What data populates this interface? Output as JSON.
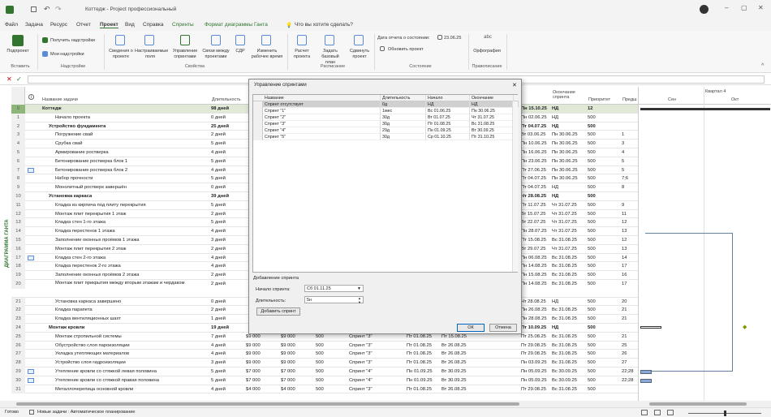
{
  "titlebar": {
    "autosave": "Автосохранение",
    "title": "Коттедж - Project профессиональный"
  },
  "tabs": [
    "Файл",
    "Задача",
    "Ресурс",
    "Отчет",
    "Проект",
    "Вид",
    "Справка",
    "Спринты",
    "Формат диаграммы Ганта"
  ],
  "tell_me": "Что вы хотите сделать?",
  "ribbon": {
    "btn_subproject": "Подпроект",
    "btn_get_addins": "Получить надстройки",
    "btn_my_addins": "Мои надстройки",
    "btn_project_info": "Сведения о проекте",
    "btn_custom_fields": "Настраиваемые поля",
    "btn_sprints": "Управление спринтами",
    "btn_links": "Связи между проектами",
    "btn_wbs": "СДР",
    "btn_work_time": "Изменить рабочее время",
    "btn_calc": "Расчет проекта",
    "btn_baseline": "Задать базовый план",
    "btn_move": "Сдвинуть проект",
    "status_date_label": "Дата отчета о состоянии:",
    "status_date": "23.06.25",
    "btn_update": "Обновить проект",
    "btn_spelling": "Орфография",
    "grp_insert": "Вставить",
    "grp_addins": "Надстройки",
    "grp_props": "Свойства",
    "grp_schedule": "Расписание",
    "grp_status": "Состояние",
    "grp_proofing": "Правописание"
  },
  "view_label": "ДИАГРАММА ГАНТА",
  "columns": {
    "name": "Название задачи",
    "duration": "Длительность",
    "start": "Начало",
    "finish": "Окончание",
    "prev": "Предш.",
    "finish2": "Окончание спринта",
    "priority": "Приоритет",
    "pred2": "Предш"
  },
  "rows": [
    {
      "id": "0",
      "name": "Коттедж",
      "dur": "98 дней",
      "start": "Пн 15.10.25",
      "fin": "НД",
      "pri": "12",
      "pred": "",
      "bold": true,
      "lvl": 0
    },
    {
      "id": "1",
      "name": "Начало проекта",
      "dur": "0 дней",
      "start": "Пн 02.06.25",
      "fin": "НД",
      "pri": "500",
      "pred": "",
      "bold": false,
      "lvl": 2
    },
    {
      "id": "2",
      "name": "Устройство фундамента",
      "dur": "25 дней",
      "start": "Пт 04.07.25",
      "fin": "НД",
      "pri": "500",
      "pred": "",
      "bold": true,
      "lvl": 1
    },
    {
      "id": "3",
      "name": "Погружение свай",
      "dur": "2 дней",
      "start": "Вт 03.06.25",
      "fin": "Пн 30.06.25",
      "pri": "500",
      "pred": "1",
      "bold": false,
      "lvl": 2
    },
    {
      "id": "4",
      "name": "Срубка свай",
      "dur": "5 дней",
      "start": "Пн 10.06.25",
      "fin": "Пн 30.06.25",
      "pri": "500",
      "pred": "3",
      "bold": false,
      "lvl": 2
    },
    {
      "id": "5",
      "name": "Армирование ростверка",
      "dur": "4 дней",
      "start": "Пн 16.06.25",
      "fin": "Пн 30.06.25",
      "pri": "500",
      "pred": "4",
      "bold": false,
      "lvl": 2
    },
    {
      "id": "6",
      "name": "Бетонирование ростверка блок 1",
      "dur": "5 дней",
      "start": "Пн 23.06.25",
      "fin": "Пн 30.06.25",
      "pri": "500",
      "pred": "5",
      "bold": false,
      "lvl": 2
    },
    {
      "id": "7",
      "name": "Бетонирование ростверка блок 2",
      "dur": "4 дней",
      "start": "Пт 27.06.25",
      "fin": "Пн 30.06.25",
      "pri": "500",
      "pred": "5",
      "bold": false,
      "lvl": 2
    },
    {
      "id": "8",
      "name": "Набор прочности",
      "dur": "5 дней",
      "start": "Пт 04.07.25",
      "fin": "Пн 30.06.25",
      "pri": "500",
      "pred": "7;6",
      "bold": false,
      "lvl": 2
    },
    {
      "id": "9",
      "name": "Монолитный ростверк завершён",
      "dur": "0 дней",
      "start": "Пт 04.07.25",
      "fin": "НД",
      "pri": "500",
      "pred": "8",
      "bold": false,
      "lvl": 2
    },
    {
      "id": "10",
      "name": "Установка каркаса",
      "dur": "39 дней",
      "start": "Чт 28.08.25",
      "fin": "НД",
      "pri": "500",
      "pred": "",
      "bold": true,
      "lvl": 1
    },
    {
      "id": "11",
      "name": "Кладка из кирпича под плиту перекрытия",
      "dur": "5 дней",
      "start": "Пт 11.07.25",
      "fin": "Чт 31.07.25",
      "pri": "500",
      "pred": "9",
      "bold": false,
      "lvl": 2
    },
    {
      "id": "12",
      "name": "Монтаж плит перекрытия 1 этаж",
      "dur": "2 дней",
      "start": "Вт 15.07.25",
      "fin": "Чт 31.07.25",
      "pri": "500",
      "pred": "11",
      "bold": false,
      "lvl": 2
    },
    {
      "id": "13",
      "name": "Кладка стен 1-го этажа",
      "dur": "5 дней",
      "start": "Вт 22.07.25",
      "fin": "Чт 31.07.25",
      "pri": "500",
      "pred": "12",
      "bold": false,
      "lvl": 2
    },
    {
      "id": "14",
      "name": "Кладка перестенок 1 этажа",
      "dur": "4 дней",
      "start": "Пн 28.07.25",
      "fin": "Чт 31.07.25",
      "pri": "500",
      "pred": "13",
      "bold": false,
      "lvl": 2
    },
    {
      "id": "15",
      "name": "Заполнение оконных проёмов 1 этажа",
      "dur": "3 дней",
      "start": "Пт 15.08.25",
      "fin": "Вс 31.08.25",
      "pri": "500",
      "pred": "12",
      "bold": false,
      "lvl": 2
    },
    {
      "id": "16",
      "name": "Монтаж плит перекрытия 2 этаж",
      "dur": "2 дней",
      "start": "Вт 29.07.25",
      "fin": "Чт 31.07.25",
      "pri": "500",
      "pred": "13",
      "bold": false,
      "lvl": 2
    },
    {
      "id": "17",
      "name": "Кладка стен 2-го этажа",
      "dur": "4 дней",
      "start": "Пн 06.08.25",
      "fin": "Вс 31.08.25",
      "pri": "500",
      "pred": "14",
      "bold": false,
      "lvl": 2
    },
    {
      "id": "18",
      "name": "Кладка перестенок 2-го этажа",
      "dur": "4 дней",
      "start": "Пн 14.08.25",
      "fin": "Вс 31.08.25",
      "pri": "500",
      "pred": "17",
      "bold": false,
      "lvl": 2
    },
    {
      "id": "19",
      "name": "Заполнение оконных проёмов 2 этажа",
      "dur": "2 дней",
      "start": "Пн 15.08.25",
      "fin": "Вс 31.08.25",
      "pri": "500",
      "pred": "16",
      "bold": false,
      "lvl": 2
    },
    {
      "id": "20",
      "name": "Монтаж плит прикрытия между вторым этажам и чердаком",
      "dur": "2 дней",
      "start": "Пн 14.08.25",
      "fin": "Вс 31.08.25",
      "pri": "500",
      "pred": "17",
      "bold": false,
      "lvl": 2,
      "tall": true
    },
    {
      "id": "21",
      "name": "Установка каркаса завершено",
      "dur": "0 дней",
      "start": "Чт 28.08.25",
      "fin": "НД",
      "pri": "500",
      "pred": "20",
      "bold": false,
      "lvl": 2
    },
    {
      "id": "22",
      "name": "Кладка парапета",
      "dur": "2 дней",
      "start": "Пн 26.08.25",
      "fin": "Вс 31.08.25",
      "pri": "500",
      "pred": "21",
      "bold": false,
      "lvl": 2
    },
    {
      "id": "23",
      "name": "Кладка вентиляционных шахт",
      "dur": "1 дней",
      "start": "Пн 28.08.25",
      "fin": "Вс 31.08.25",
      "pri": "500",
      "pred": "21",
      "bold": false,
      "lvl": 2
    },
    {
      "id": "24",
      "name": "Монтаж кровли",
      "dur": "19 дней",
      "start": "Пт 10.09.25",
      "fin": "НД",
      "pri": "500",
      "pred": "",
      "bold": true,
      "lvl": 1
    },
    {
      "id": "25",
      "name": "Монтаж стропильной системы",
      "dur": "7 дней",
      "cost": "$9 000",
      "cost2": "$9 000",
      "w": "500",
      "sprint": "Спринт \"3\"",
      "s": "Пт 01.08.25",
      "f": "Пт 15.08.25",
      "start": "Пт 25.08.25",
      "fin": "Вс 31.08.25",
      "pri": "500",
      "pred": "21",
      "bold": false,
      "lvl": 2
    },
    {
      "id": "26",
      "name": "Обустройство слоя пароизоляции",
      "dur": "4 дней",
      "cost": "$9 000",
      "cost2": "$9 000",
      "w": "500",
      "sprint": "Спринт \"3\"",
      "s": "Пт 01.08.25",
      "f": "Вт 26.08.25",
      "start": "Пт 29.08.25",
      "fin": "Вс 31.08.25",
      "pri": "500",
      "pred": "25",
      "bold": false,
      "lvl": 2
    },
    {
      "id": "27",
      "name": "Укладка утепляющих материалов",
      "dur": "4 дней",
      "cost": "$9 000",
      "cost2": "$9 000",
      "w": "500",
      "sprint": "Спринт \"3\"",
      "s": "Пт 01.08.25",
      "f": "Вт 26.08.25",
      "start": "Пт 29.08.25",
      "fin": "Вс 31.08.25",
      "pri": "500",
      "pred": "26",
      "bold": false,
      "lvl": 2
    },
    {
      "id": "28",
      "name": "Устройство слоя гидроизоляции",
      "dur": "3 дней",
      "cost": "$9 000",
      "cost2": "$9 000",
      "w": "500",
      "sprint": "Спринт \"3\"",
      "s": "Пт 01.08.25",
      "f": "Вт 26.08.25",
      "start": "Пн 03.09.25",
      "fin": "Вс 31.08.25",
      "pri": "500",
      "pred": "27",
      "bold": false,
      "lvl": 2
    },
    {
      "id": "29",
      "name": "Утепление кровли со стяжкой левая половина",
      "dur": "5 дней",
      "cost": "$7 000",
      "cost2": "$7 000",
      "w": "500",
      "sprint": "Спринт \"4\"",
      "s": "Пн 01.09.25",
      "f": "Вт 30.09.25",
      "start": "Пн 05.09.25",
      "fin": "Вс 30.09.25",
      "pri": "500",
      "pred": "22;28",
      "bold": false,
      "lvl": 2
    },
    {
      "id": "30",
      "name": "Утепление кровли со стяжкой правая половина",
      "dur": "5 дней",
      "cost": "$7 000",
      "cost2": "$7 000",
      "w": "500",
      "sprint": "Спринт \"4\"",
      "s": "Пн 01.09.25",
      "f": "Вт 30.09.25",
      "start": "Пн 05.09.25",
      "fin": "Вс 30.09.25",
      "pri": "500",
      "pred": "22;28",
      "bold": false,
      "lvl": 2
    },
    {
      "id": "31",
      "name": "Металлочерепица основной кровли",
      "dur": "4 дней",
      "cost": "$4 000",
      "cost2": "$4 000",
      "w": "500",
      "sprint": "Спринт \"3\"",
      "s": "Пт 01.08.25",
      "f": "Вт 26.08.25",
      "start": "Пт 29.08.25",
      "fin": "Вс 31.08.25",
      "pri": "500",
      "pred": "",
      "bold": false,
      "lvl": 2
    }
  ],
  "gantt": {
    "quarter": "Квартал 4",
    "months": [
      "Сен",
      "Окт"
    ]
  },
  "dialog": {
    "title": "Управление спринтами",
    "cols": [
      "Название",
      "Длительность",
      "Начало",
      "Окончание"
    ],
    "rows": [
      {
        "n": "Спринт отсутствует",
        "d": "0д",
        "s": "НД",
        "f": "НД"
      },
      {
        "n": "Спринт \"1\"",
        "d": "1мес",
        "s": "Вс 01.06.25",
        "f": "Пн 30.06.25"
      },
      {
        "n": "Спринт \"2\"",
        "d": "30д",
        "s": "Вт 01.07.25",
        "f": "Чт 31.07.25"
      },
      {
        "n": "Спринт \"3\"",
        "d": "30д",
        "s": "Пт 01.08.25",
        "f": "Вс 31.08.25"
      },
      {
        "n": "Спринт \"4\"",
        "d": "29д",
        "s": "Пн 01.09.25",
        "f": "Вт 30.09.25"
      },
      {
        "n": "Спринт \"5\"",
        "d": "30д",
        "s": "Ср 01.10.25",
        "f": "Пт 31.10.25"
      }
    ],
    "add_section": "Добавление спринта",
    "start_label": "Начало спринта:",
    "start_value": "Сб 01.11.25",
    "dur_label": "Длительность:",
    "dur_value": "5н",
    "add_btn": "Добавить спринт",
    "ok": "ОК",
    "cancel": "Отмена"
  },
  "status": {
    "ready": "Готово",
    "new_tasks": "Новые задачи : Автоматическое планирование"
  }
}
